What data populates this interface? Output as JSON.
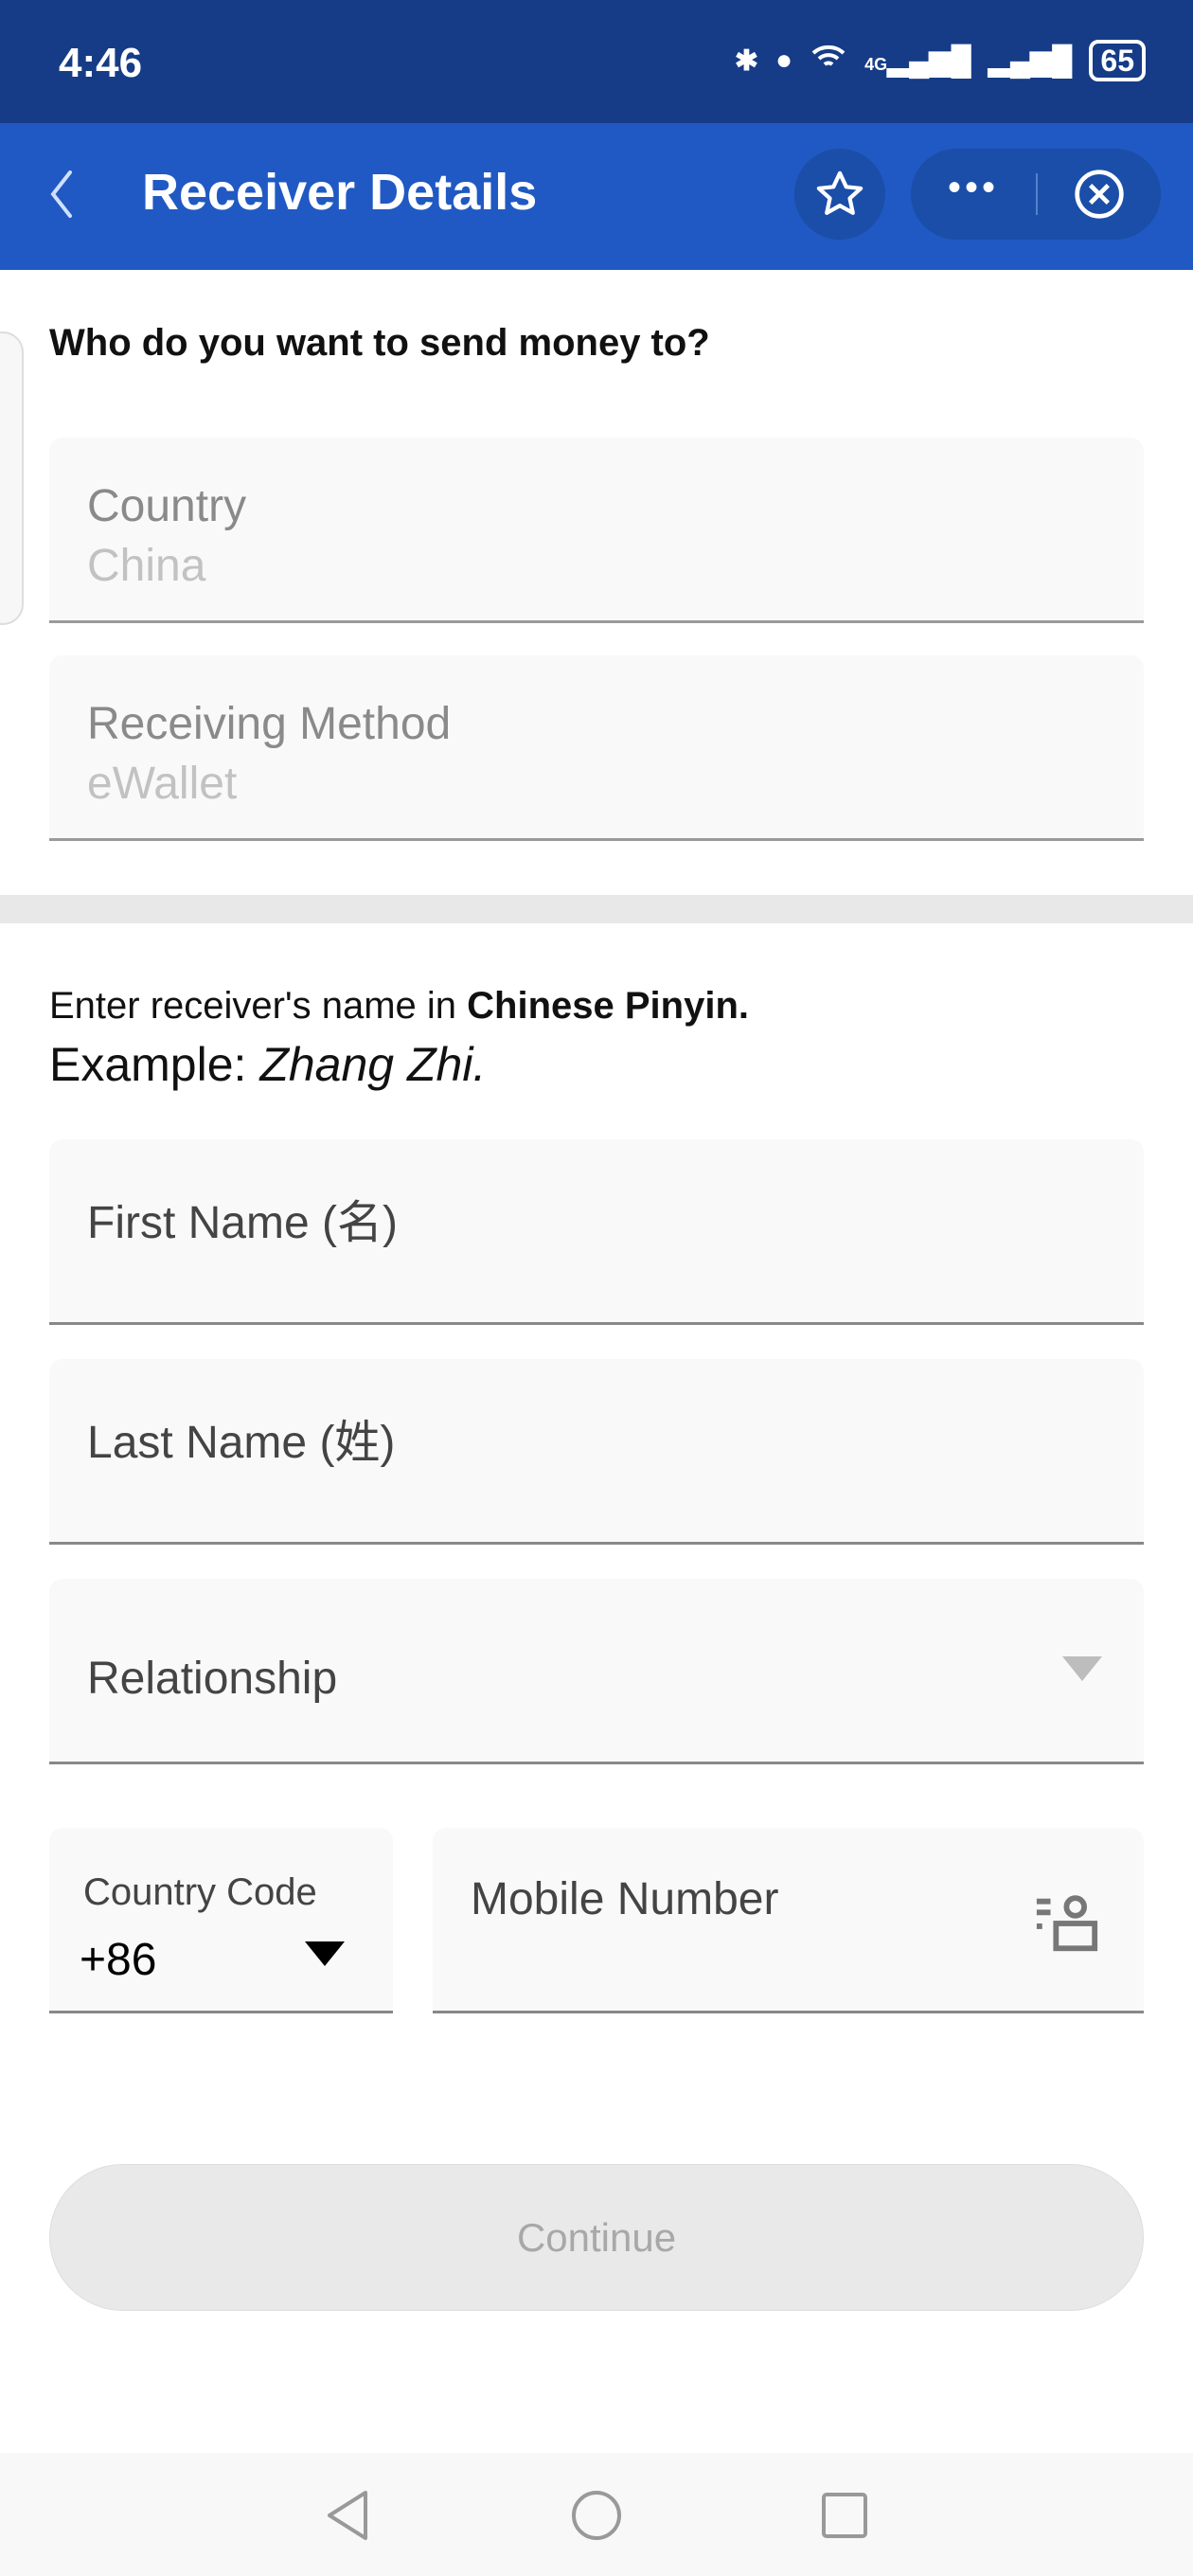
{
  "status_bar": {
    "time": "4:46",
    "battery": "65",
    "network": "4G"
  },
  "header": {
    "title": "Receiver Details"
  },
  "section1": {
    "heading": "Who do you want to send money to?",
    "country": {
      "label": "Country",
      "value": "China"
    },
    "method": {
      "label": "Receiving Method",
      "value": "eWallet"
    }
  },
  "section2": {
    "hint_prefix": "Enter receiver's name in ",
    "hint_bold": "Chinese Pinyin.",
    "example_prefix": "Example: ",
    "example_value": "Zhang Zhi.",
    "first_name": {
      "label": "First Name (名)"
    },
    "last_name": {
      "label": "Last Name (姓)"
    },
    "relationship": {
      "label": "Relationship"
    },
    "country_code": {
      "label": "Country Code",
      "value": "+86"
    },
    "mobile": {
      "label": "Mobile Number"
    }
  },
  "footer": {
    "continue": "Continue"
  }
}
